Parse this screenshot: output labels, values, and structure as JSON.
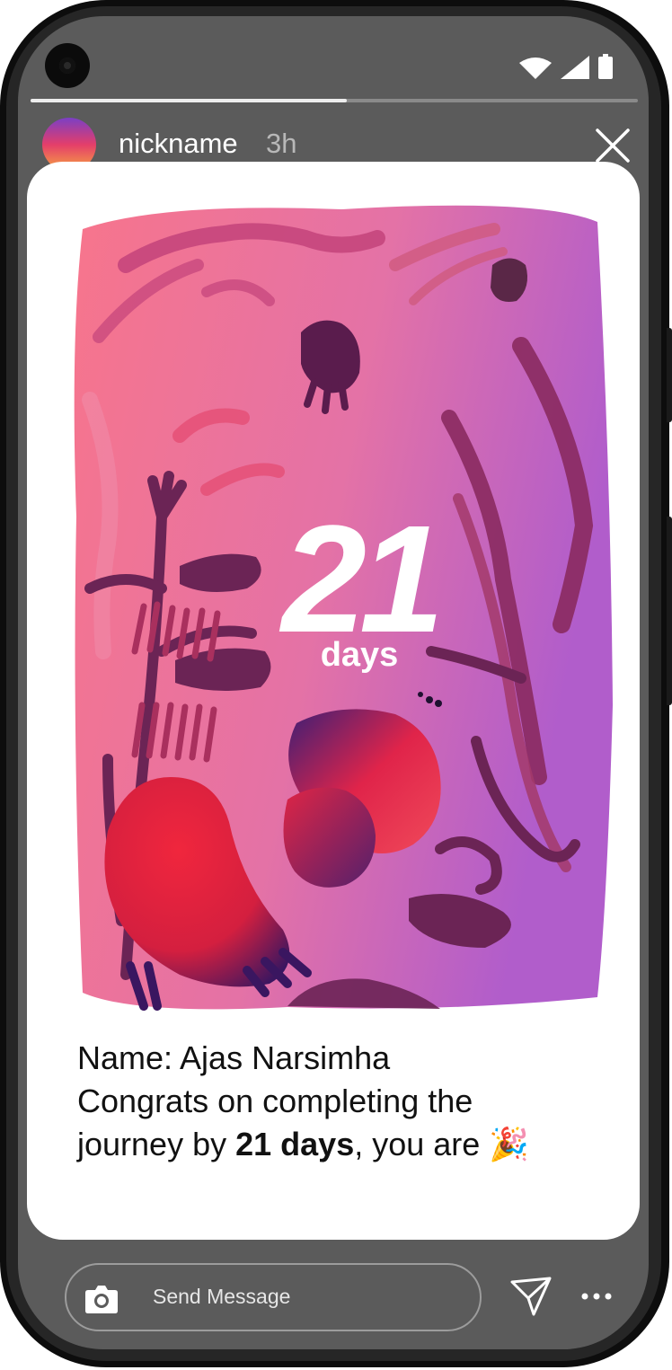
{
  "story": {
    "username": "nickname",
    "time_ago": "3h",
    "progress": 0.52
  },
  "card": {
    "big_number": "21",
    "big_unit": "days",
    "message": {
      "line1": "Name: Ajas Narsimha",
      "line2": "Congrats on completing the",
      "line3_prefix": "journey by ",
      "line3_bold": "21 days",
      "line3_suffix": ", you are",
      "emoji": "🎉"
    }
  },
  "footer": {
    "placeholder": "Send Message"
  },
  "icons": {
    "status": [
      "wifi-icon",
      "signal-icon",
      "battery-icon"
    ],
    "close": "close-icon",
    "camera": "camera-icon",
    "send": "send-icon",
    "more": "more-icon"
  },
  "colors": {
    "screen_bg": "#5b5b5b",
    "art_pink": "#f26b8a",
    "art_purple": "#b45ec9",
    "art_dark_plum": "#6b2455",
    "art_red": "#e42a43"
  }
}
